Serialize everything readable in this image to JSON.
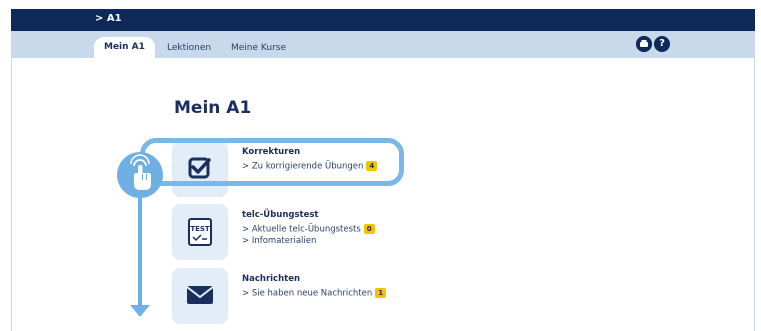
{
  "breadcrumb": "> A1",
  "tabs": [
    {
      "label": "Mein A1",
      "active": true
    },
    {
      "label": "Lektionen",
      "active": false
    },
    {
      "label": "Meine Kurse",
      "active": false
    }
  ],
  "toolbar": {
    "print_icon": "print-icon",
    "help_icon": "help-icon"
  },
  "page_title": "Mein A1",
  "items": [
    {
      "icon": "checkbox-checked-icon",
      "title": "Korrekturen",
      "links": [
        {
          "text": "> Zu korrigierende Übungen",
          "badge": "4"
        }
      ]
    },
    {
      "icon": "test-document-icon",
      "icon_text": "TEST",
      "title": "telc-Übungstest",
      "links": [
        {
          "text": "> Aktuelle telc-Übungstests",
          "badge": "0"
        },
        {
          "text": "> Infomaterialien",
          "badge": ""
        }
      ]
    },
    {
      "icon": "envelope-icon",
      "title": "Nachrichten",
      "links": [
        {
          "text": "> Sie haben neue Nachrichten",
          "badge": "1"
        }
      ]
    }
  ],
  "colors": {
    "navy": "#0d2a5a",
    "tabbar": "#c7d9ea",
    "highlight": "#7ab8e8",
    "badge": "#f4c300"
  }
}
